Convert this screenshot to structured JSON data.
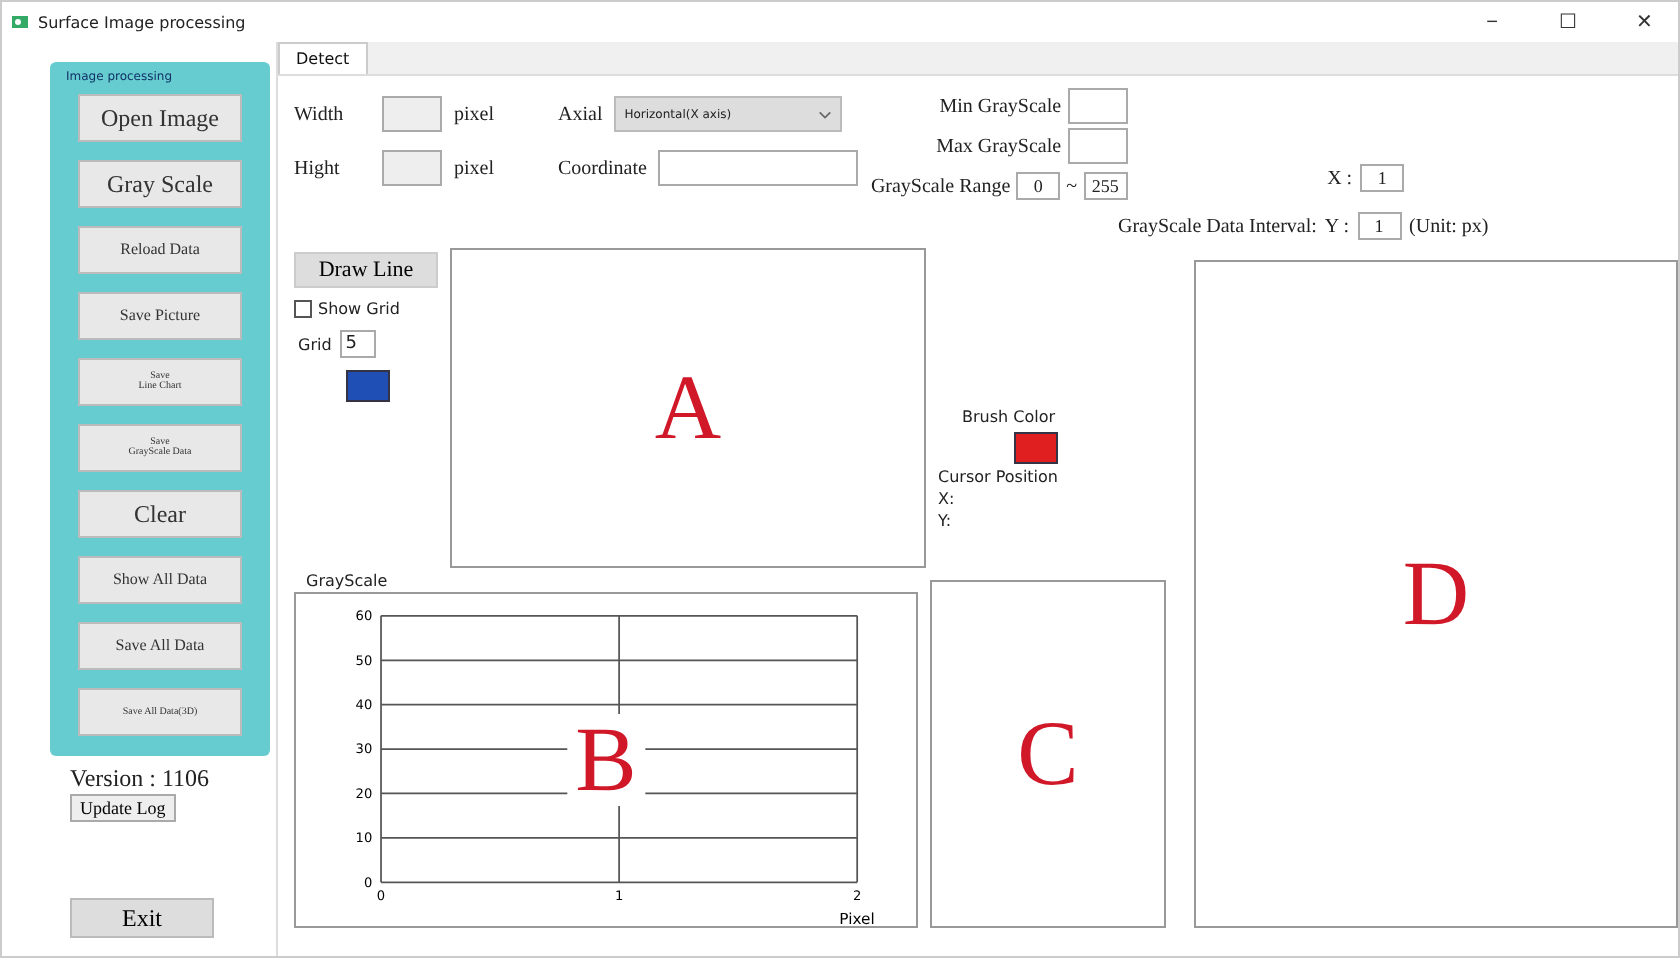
{
  "window": {
    "title": "Surface Image processing",
    "controls": [
      "−",
      "☐",
      "✕"
    ]
  },
  "sidebar": {
    "title": "Image processing",
    "buttons": [
      {
        "label": "Open Image",
        "kind": "large"
      },
      {
        "label": "Gray Scale",
        "kind": "large"
      },
      {
        "label": "Reload Data",
        "kind": "medium"
      },
      {
        "label": "Save Picture",
        "kind": "medium"
      },
      {
        "label": "Save\nLine Chart",
        "kind": "small"
      },
      {
        "label": "Save\nGrayScale Data",
        "kind": "small"
      },
      {
        "label": "Clear",
        "kind": "large"
      },
      {
        "label": "Show All Data",
        "kind": "medium"
      },
      {
        "label": "Save All Data",
        "kind": "medium"
      },
      {
        "label": "Save All Data(3D)",
        "kind": "small"
      }
    ]
  },
  "version": "Version : 1106",
  "update_log": "Update Log",
  "exit": "Exit",
  "tabs": [
    {
      "label": "Detect",
      "selected": true
    }
  ],
  "fields": {
    "width_label": "Width",
    "width_unit": "pixel",
    "hight_label": "Hight",
    "hight_unit": "pixel",
    "axial_label": "Axial",
    "axial_value": "Horizontal(X axis)",
    "coordinate_label": "Coordinate",
    "min_label": "Min GrayScale",
    "max_label": "Max GrayScale",
    "range_label": "GrayScale Range",
    "range_min": "0",
    "range_sep": "~",
    "range_max": "255",
    "interval_label": "GrayScale Data Interval:",
    "x_label": "X :",
    "x_value": "1",
    "y_label": "Y :",
    "y_value": "1",
    "unit": "(Unit: px)"
  },
  "tools": {
    "draw_line": "Draw Line",
    "show_grid": {
      "label": "Show Grid",
      "checked": false
    },
    "grid": {
      "label": "Grid",
      "value": "5",
      "color": "#1f4fb4"
    }
  },
  "brush": {
    "label": "Brush Color",
    "color": "#e02020"
  },
  "cursor": {
    "label": "Cursor Position",
    "x": "X:",
    "y": "Y:"
  },
  "markers": [
    "A",
    "B",
    "C",
    "D"
  ],
  "chart": {
    "chart_data": {
      "type": "line",
      "title": "GrayScale",
      "xlabel": "Pixel",
      "xlim": [
        0,
        2
      ],
      "ylim": [
        0,
        60
      ],
      "xticks": [
        0,
        1,
        2
      ],
      "yticks": [
        0,
        10,
        20,
        30,
        40,
        50,
        60
      ],
      "grid": true
    }
  }
}
